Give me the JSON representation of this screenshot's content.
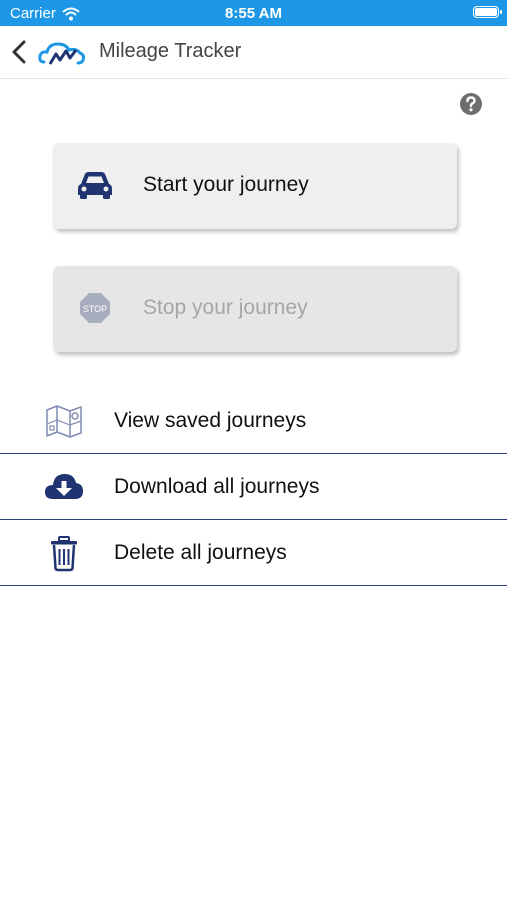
{
  "status": {
    "carrier": "Carrier",
    "time": "8:55 AM"
  },
  "nav": {
    "title": "Mileage Tracker"
  },
  "actions": {
    "start_label": "Start your journey",
    "stop_label": "Stop your journey",
    "stop_icon_text": "STOP"
  },
  "menu": [
    {
      "label": "View saved journeys",
      "icon": "map-icon"
    },
    {
      "label": "Download all journeys",
      "icon": "cloud-download-icon"
    },
    {
      "label": "Delete all journeys",
      "icon": "trash-icon"
    }
  ],
  "colors": {
    "status_bar": "#1e98e6",
    "brand_navy": "#1f3471",
    "divider": "#2c3f7a",
    "disabled_text": "#a6a6a6"
  }
}
